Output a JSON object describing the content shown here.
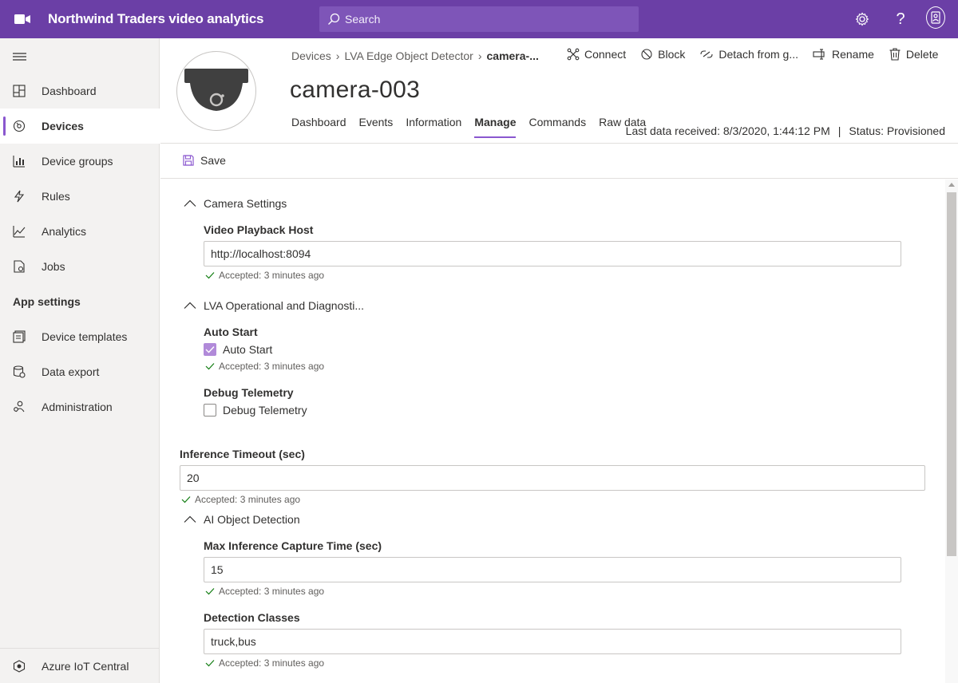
{
  "app": {
    "title": "Northwind Traders video analytics"
  },
  "search": {
    "placeholder": "Search"
  },
  "topbar": {
    "icons": [
      "settings-icon",
      "help-icon",
      "user-icon"
    ],
    "brand_color": "#6b3fa6"
  },
  "sidebar": {
    "items": [
      {
        "label": "Dashboard",
        "icon": "dashboard-icon"
      },
      {
        "label": "Devices",
        "icon": "devices-icon",
        "active": true
      },
      {
        "label": "Device groups",
        "icon": "device-groups-icon"
      },
      {
        "label": "Rules",
        "icon": "rules-icon"
      },
      {
        "label": "Analytics",
        "icon": "analytics-icon"
      },
      {
        "label": "Jobs",
        "icon": "jobs-icon"
      }
    ],
    "section_label": "App settings",
    "settings_items": [
      {
        "label": "Device templates",
        "icon": "device-templates-icon"
      },
      {
        "label": "Data export",
        "icon": "data-export-icon"
      },
      {
        "label": "Administration",
        "icon": "administration-icon"
      }
    ],
    "footer": {
      "label": "Azure IoT Central",
      "icon": "iot-central-icon"
    }
  },
  "breadcrumb": {
    "root": "Devices",
    "template": "LVA Edge Object Detector",
    "current": "camera-..."
  },
  "commands": {
    "connect": "Connect",
    "block": "Block",
    "detach": "Detach from g...",
    "rename": "Rename",
    "delete": "Delete"
  },
  "device": {
    "name": "camera-003"
  },
  "tabs": [
    {
      "label": "Dashboard"
    },
    {
      "label": "Events"
    },
    {
      "label": "Information"
    },
    {
      "label": "Manage",
      "active": true
    },
    {
      "label": "Commands"
    },
    {
      "label": "Raw data"
    }
  ],
  "status": {
    "last_data": "Last data received: 8/3/2020, 1:44:12 PM",
    "separator": "|",
    "provisioning": "Status: Provisioned"
  },
  "toolbar": {
    "save_label": "Save"
  },
  "form": {
    "camera_settings": {
      "title": "Camera Settings",
      "playback_label": "Video Playback Host",
      "playback_value": "http://localhost:8094",
      "playback_status": "Accepted: 3 minutes ago"
    },
    "lva": {
      "title": "LVA Operational and Diagnosti...",
      "auto_start_label": "Auto Start",
      "auto_start_checkbox": "Auto Start",
      "auto_start_checked": true,
      "auto_start_status": "Accepted: 3 minutes ago",
      "debug_label": "Debug Telemetry",
      "debug_checkbox": "Debug Telemetry",
      "debug_checked": false
    },
    "inference_timeout": {
      "label": "Inference Timeout (sec)",
      "value": "20",
      "status": "Accepted: 3 minutes ago"
    },
    "ai_detection": {
      "title": "AI Object Detection",
      "capture_label": "Max Inference Capture Time (sec)",
      "capture_value": "15",
      "capture_status": "Accepted: 3 minutes ago",
      "classes_label": "Detection Classes",
      "classes_value": "truck,bus",
      "classes_status": "Accepted: 3 minutes ago"
    }
  },
  "colors": {
    "accent": "#8a57cf",
    "check_green": "#107c10"
  }
}
